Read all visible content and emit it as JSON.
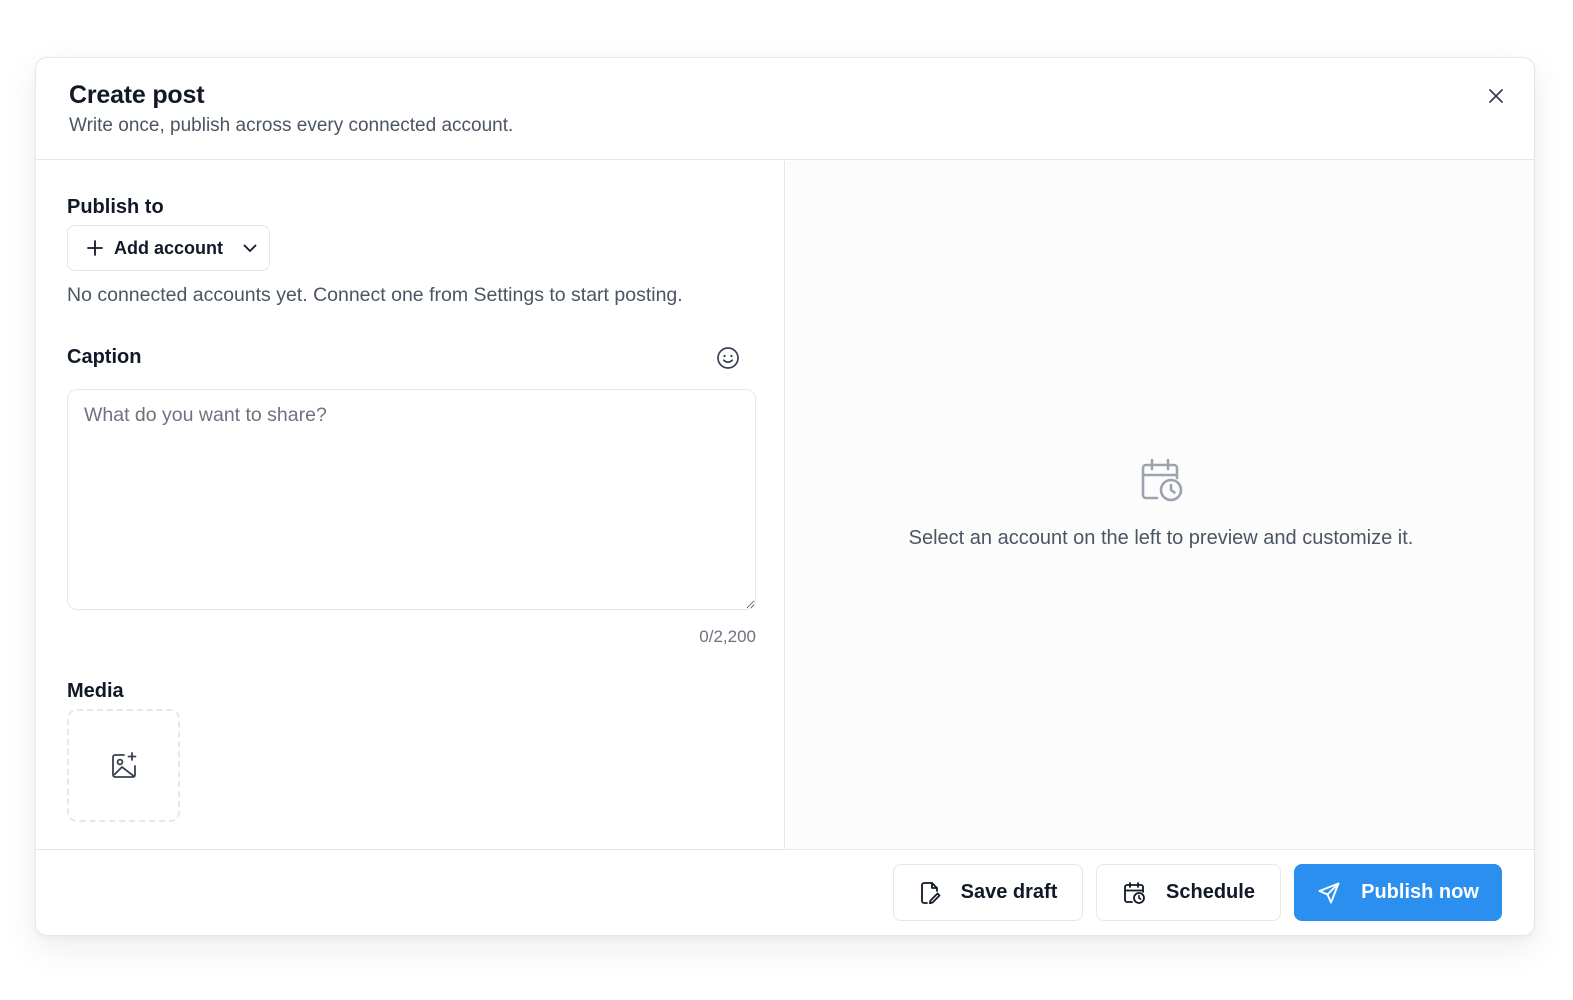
{
  "modal": {
    "title": "Create post",
    "subtitle": "Write once, publish across every connected account."
  },
  "publish_to": {
    "label": "Publish to",
    "add_account_label": "Add account",
    "hint": "No connected accounts yet. Connect one from Settings to start posting."
  },
  "caption": {
    "label": "Caption",
    "value": "",
    "placeholder": "What do you want to share?",
    "counter": "0/2,200"
  },
  "media": {
    "label": "Media"
  },
  "preview": {
    "empty_text": "Select an account on the left to preview and customize it."
  },
  "footer": {
    "save_draft_label": "Save draft",
    "schedule_label": "Schedule",
    "publish_label": "Publish now"
  },
  "icons": {
    "close": "close-icon",
    "plus": "plus-icon",
    "chevron": "chevron-down-icon",
    "emoji": "smile-icon",
    "add_image": "image-plus-icon",
    "calendar_clock": "calendar-clock-icon",
    "file_edit": "file-edit-icon",
    "send": "send-icon"
  },
  "colors": {
    "primary": "#2b8ff0",
    "border": "#e5e7eb",
    "text": "#111827",
    "muted": "#4b5563"
  }
}
